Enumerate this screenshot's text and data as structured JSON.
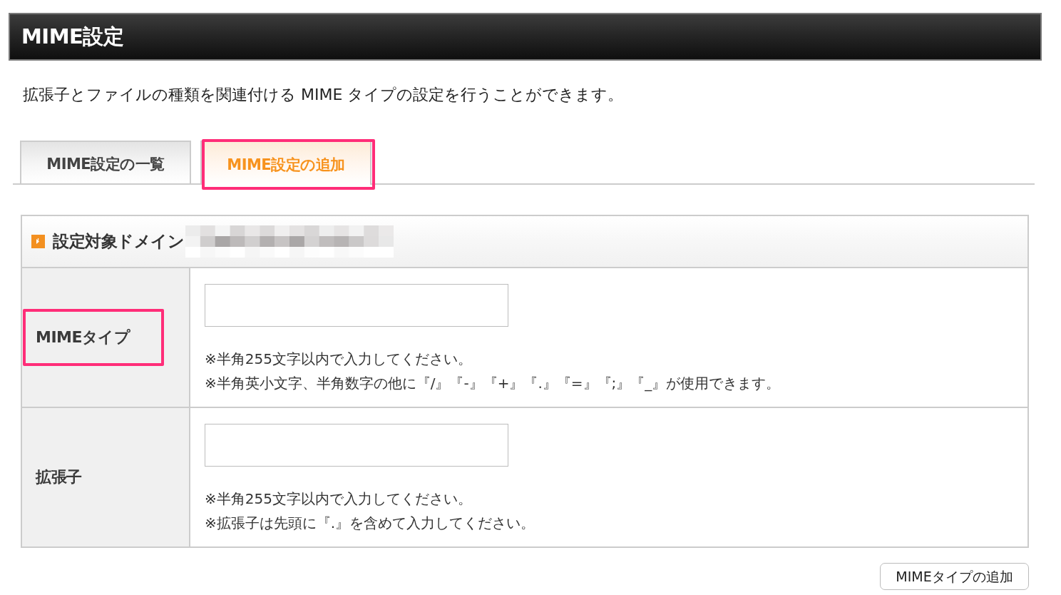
{
  "header": {
    "title": "MIME設定"
  },
  "description": "拡張子とファイルの種類を関連付ける MIME タイプの設定を行うことができます。",
  "tabs": [
    {
      "label": "MIME設定の一覧",
      "selected": false,
      "highlighted": false
    },
    {
      "label": "MIME設定の追加",
      "selected": true,
      "highlighted": true
    }
  ],
  "form": {
    "heading": "設定対象ドメイン",
    "rows": [
      {
        "label": "MIMEタイプ",
        "highlighted": true,
        "notes": [
          "※半角255文字以内で入力してください。",
          "※半角英小文字、半角数字の他に『/』『-』『+』『.』『=』『;』『_』が使用できます。"
        ]
      },
      {
        "label": "拡張子",
        "highlighted": false,
        "notes": [
          "※半角255文字以内で入力してください。",
          "※拡張子は先頭に『.』を含めて入力してください。"
        ]
      }
    ]
  },
  "submit_button": "MIMEタイプの追加"
}
